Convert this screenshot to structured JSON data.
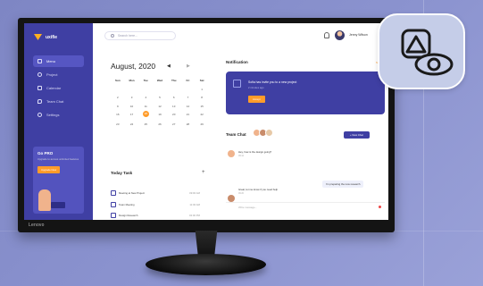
{
  "monitor": {
    "brand": "Lenovo"
  },
  "app": {
    "logo_text": "uxifie",
    "nav": [
      {
        "label": "Menu",
        "icon": "grid-icon"
      },
      {
        "label": "Project",
        "icon": "clock-icon"
      },
      {
        "label": "Calendar",
        "icon": "calendar-icon"
      },
      {
        "label": "Team Chat",
        "icon": "chat-icon"
      },
      {
        "label": "Settings",
        "icon": "gear-icon"
      }
    ],
    "promo": {
      "title": "Go PRO",
      "text": "Upgrade to access unlimited features",
      "button": "Upgrade Now"
    },
    "search_placeholder": "Search here...",
    "user_name": "Jenny Wilson",
    "calendar": {
      "title": "August, 2020",
      "days": [
        "Sun",
        "Mon",
        "Tue",
        "Wed",
        "Thu",
        "Fri",
        "Sat"
      ],
      "weeks": [
        [
          "",
          "",
          "",
          "",
          "",
          "",
          "1"
        ],
        [
          "2",
          "3",
          "4",
          "5",
          "6",
          "7",
          "8"
        ],
        [
          "9",
          "10",
          "11",
          "12",
          "13",
          "14",
          "15"
        ],
        [
          "16",
          "17",
          "18",
          "19",
          "20",
          "21",
          "22"
        ],
        [
          "23",
          "24",
          "25",
          "26",
          "27",
          "28",
          "29"
        ]
      ],
      "today": "18"
    },
    "tasks": {
      "title": "Today Task",
      "items": [
        {
          "label": "Meeting at New Project",
          "time": "09:00 AM"
        },
        {
          "label": "Team Meeting",
          "time": "11:00 AM"
        },
        {
          "label": "Design Research",
          "time": "02:00 PM"
        }
      ]
    },
    "notification": {
      "title": "Notification",
      "link": "See all",
      "text": "Sofia has invite you to a new project",
      "sub": "2 minutes ago",
      "button": "Accept"
    },
    "chat": {
      "title": "Team Chat",
      "new_button": "+ New Chat",
      "messages": [
        {
          "text": "Hey, how is the design going?",
          "time": "09:12"
        },
        {
          "text": "I'm preparing the new research",
          "time": "09:15"
        },
        {
          "text": "Great, let me know if you need help",
          "time": "09:20"
        }
      ],
      "input_placeholder": "Write message..."
    }
  },
  "badge": {
    "icon": "triangle-eye-icon"
  }
}
